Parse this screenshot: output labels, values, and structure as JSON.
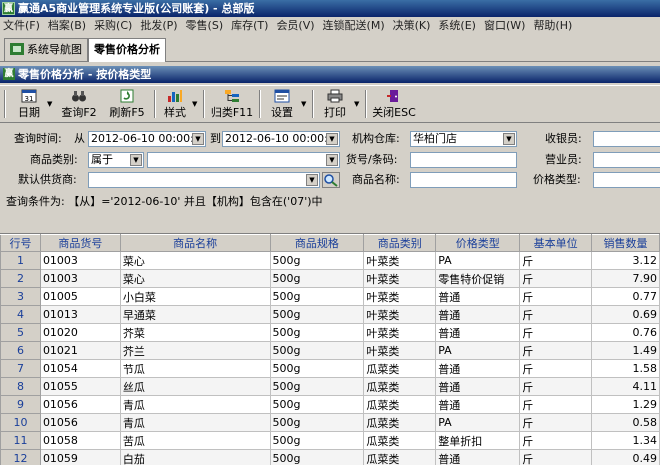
{
  "window": {
    "title": "赢通A5商业管理系统专业版(公司账套) - 总部版",
    "app_icon": "赢"
  },
  "menu": [
    "文件(F)",
    "档案(B)",
    "采购(C)",
    "批发(P)",
    "零售(S)",
    "库存(T)",
    "会员(V)",
    "连锁配送(M)",
    "决策(K)",
    "系统(E)",
    "窗口(W)",
    "帮助(H)"
  ],
  "tabs": [
    {
      "label": "系统导航图"
    },
    {
      "label": "零售价格分析"
    }
  ],
  "module_title": "零售价格分析 - 按价格类型",
  "toolbar": {
    "date": "日期",
    "query": "查询F2",
    "refresh": "刷新F5",
    "style": "样式",
    "category": "归类F11",
    "settings": "设置",
    "print": "打印",
    "close": "关闭ESC"
  },
  "filters": {
    "query_time_label": "查询时间:",
    "from_label": "从",
    "from_value": "2012-06-10 00:00:0",
    "to_label": "到",
    "to_value": "2012-06-10 00:00:0",
    "warehouse_label": "机构仓库:",
    "warehouse_value": "华柏门店",
    "cashier_label": "收银员:",
    "cashier_value": "",
    "product_category_label": "商品类别:",
    "category_mode": "属于",
    "category_value": "",
    "barcode_label": "货号/条码:",
    "barcode_value": "",
    "salesperson_label": "营业员:",
    "salesperson_value": "",
    "supplier_label": "默认供货商:",
    "supplier_value": "",
    "product_name_label": "商品名称:",
    "product_name_value": "",
    "price_type_label": "价格类型:",
    "price_type_value": ""
  },
  "condition_text": "查询条件为: 【从】='2012-06-10' 并且【机构】包含在('07')中",
  "table": {
    "columns": [
      "行号",
      "商品货号",
      "商品名称",
      "商品规格",
      "商品类别",
      "价格类型",
      "基本单位",
      "销售数量"
    ],
    "rows": [
      [
        "1",
        "01003",
        "菜心",
        "500g",
        "叶菜类",
        "PA",
        "斤",
        "3.12"
      ],
      [
        "2",
        "01003",
        "菜心",
        "500g",
        "叶菜类",
        "零售特价促销",
        "斤",
        "7.90"
      ],
      [
        "3",
        "01005",
        "小白菜",
        "500g",
        "叶菜类",
        "普通",
        "斤",
        "0.77"
      ],
      [
        "4",
        "01013",
        "早通菜",
        "500g",
        "叶菜类",
        "普通",
        "斤",
        "0.69"
      ],
      [
        "5",
        "01020",
        "芥菜",
        "500g",
        "叶菜类",
        "普通",
        "斤",
        "0.76"
      ],
      [
        "6",
        "01021",
        "芥兰",
        "500g",
        "叶菜类",
        "PA",
        "斤",
        "1.49"
      ],
      [
        "7",
        "01054",
        "节瓜",
        "500g",
        "瓜菜类",
        "普通",
        "斤",
        "1.58"
      ],
      [
        "8",
        "01055",
        "丝瓜",
        "500g",
        "瓜菜类",
        "普通",
        "斤",
        "4.11"
      ],
      [
        "9",
        "01056",
        "青瓜",
        "500g",
        "瓜菜类",
        "普通",
        "斤",
        "1.29"
      ],
      [
        "10",
        "01056",
        "青瓜",
        "500g",
        "瓜菜类",
        "PA",
        "斤",
        "0.58"
      ],
      [
        "11",
        "01058",
        "苦瓜",
        "500g",
        "瓜菜类",
        "整单折扣",
        "斤",
        "1.34"
      ],
      [
        "12",
        "01059",
        "白茄",
        "500g",
        "瓜菜类",
        "普通",
        "斤",
        "0.49"
      ]
    ]
  },
  "colors": {
    "title_bar": "#0a246a",
    "header_text": "#1a3f9a",
    "window_bg": "#d4d0c8"
  }
}
